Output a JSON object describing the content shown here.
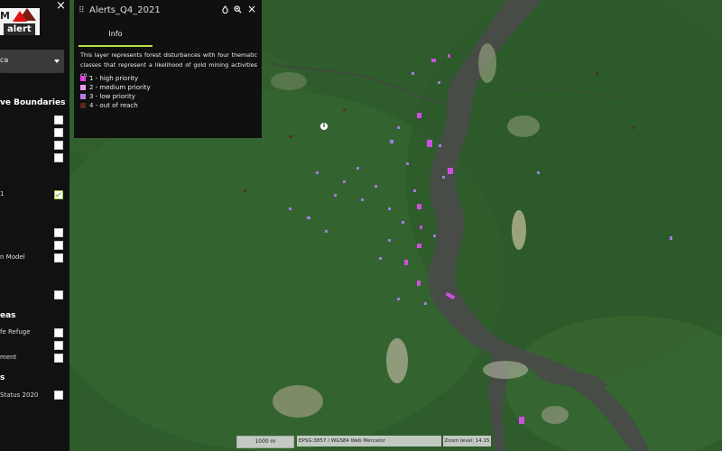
{
  "logo": {
    "prefix": "M",
    "text": "alert"
  },
  "sidebar": {
    "close_icon": "×",
    "region_value": "ca",
    "section_boundaries": "ve Boundaries",
    "items": [
      {
        "label": "",
        "checked": false
      },
      {
        "label": "",
        "checked": false
      },
      {
        "label": "",
        "checked": false
      },
      {
        "label": "",
        "checked": false
      },
      {
        "label": "1",
        "checked": true
      },
      {
        "label": "",
        "checked": false
      },
      {
        "label": "",
        "checked": false
      },
      {
        "label": "n Model",
        "checked": false
      },
      {
        "label": "",
        "checked": false
      }
    ],
    "section_areas": "eas",
    "items2": [
      {
        "label": "fe Refuge",
        "checked": false
      },
      {
        "label": "",
        "checked": false
      },
      {
        "label": "ment",
        "checked": false
      }
    ],
    "section_s": "s",
    "status_label": "Status 2020"
  },
  "panel": {
    "drag_icon": "⠿",
    "title": "Alerts_Q4_2021",
    "opacity_icon": "droplet-icon",
    "zoom_icon": "zoom-in-icon",
    "close_icon": "×",
    "tab": "Info",
    "description": "This layer represents forest disturbances with four thematic classes that represent a likelihood of gold mining activities co...",
    "legend": [
      {
        "label": "1 - high priority",
        "color": "#e040e0"
      },
      {
        "label": "2 - medium priority",
        "color": "#e89ce8"
      },
      {
        "label": "3 - low priority",
        "color": "#b77ee0"
      },
      {
        "label": "4 - out of reach",
        "color": "#5a2a18"
      }
    ],
    "info_icon": "i"
  },
  "footer": {
    "scale": "1000 m",
    "projection": "EPSG:3857 / WGS84 Web Mercator",
    "zoom": "Zoom level: 14.15"
  },
  "colors": {
    "forest": "#2d5a2a",
    "river": "#4a4f4a",
    "alert_high": "#e040e0",
    "alert_low": "#a070e0"
  }
}
